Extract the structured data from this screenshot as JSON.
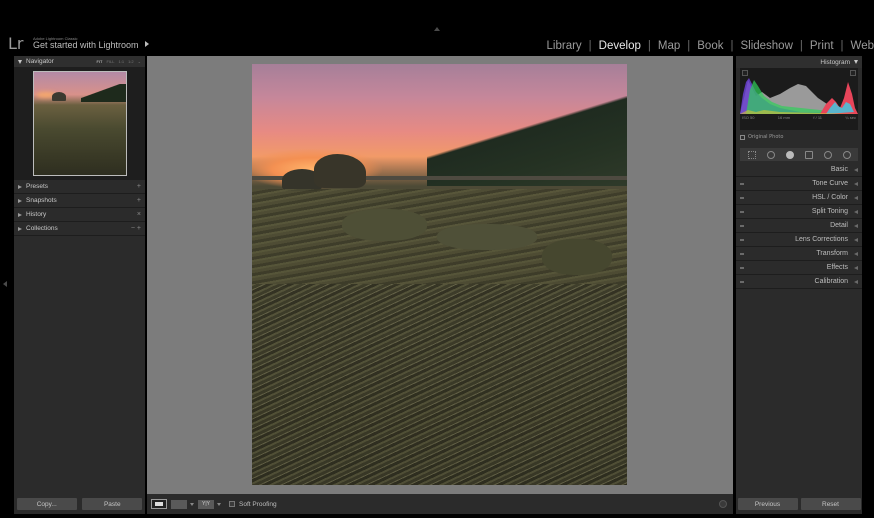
{
  "app": {
    "logo": "Lr",
    "brand_small": "Adobe Lightroom Classic",
    "title": "Get started with Lightroom"
  },
  "modules": [
    "Library",
    "Develop",
    "Map",
    "Book",
    "Slideshow",
    "Print",
    "Web"
  ],
  "active_module": "Develop",
  "left_panel": {
    "navigator_label": "Navigator",
    "zoom_options": [
      "FIT",
      "FILL",
      "1:1",
      "1:2",
      "⌄"
    ],
    "sections": [
      {
        "label": "Presets",
        "action": "+"
      },
      {
        "label": "Snapshots",
        "action": "+"
      },
      {
        "label": "History",
        "action": "×"
      },
      {
        "label": "Collections",
        "action": "−  +"
      }
    ],
    "copy_label": "Copy...",
    "paste_label": "Paste"
  },
  "right_panel": {
    "histogram_label": "Histogram",
    "hist_info": [
      "ISO 50",
      "16 mm",
      "f / 11",
      "¼ sec"
    ],
    "original_photo_label": "Original Photo",
    "sections": [
      "Basic",
      "Tone Curve",
      "HSL / Color",
      "Split Toning",
      "Detail",
      "Lens Corrections",
      "Transform",
      "Effects",
      "Calibration"
    ],
    "previous_label": "Previous",
    "reset_label": "Reset"
  },
  "toolbar": {
    "yy_label": "Y|Y",
    "soft_proofing_label": "Soft Proofing"
  },
  "colors": {
    "panel": "#2b2b2b",
    "canvas": "#7c7c7c",
    "active_text": "#eaeaea"
  }
}
